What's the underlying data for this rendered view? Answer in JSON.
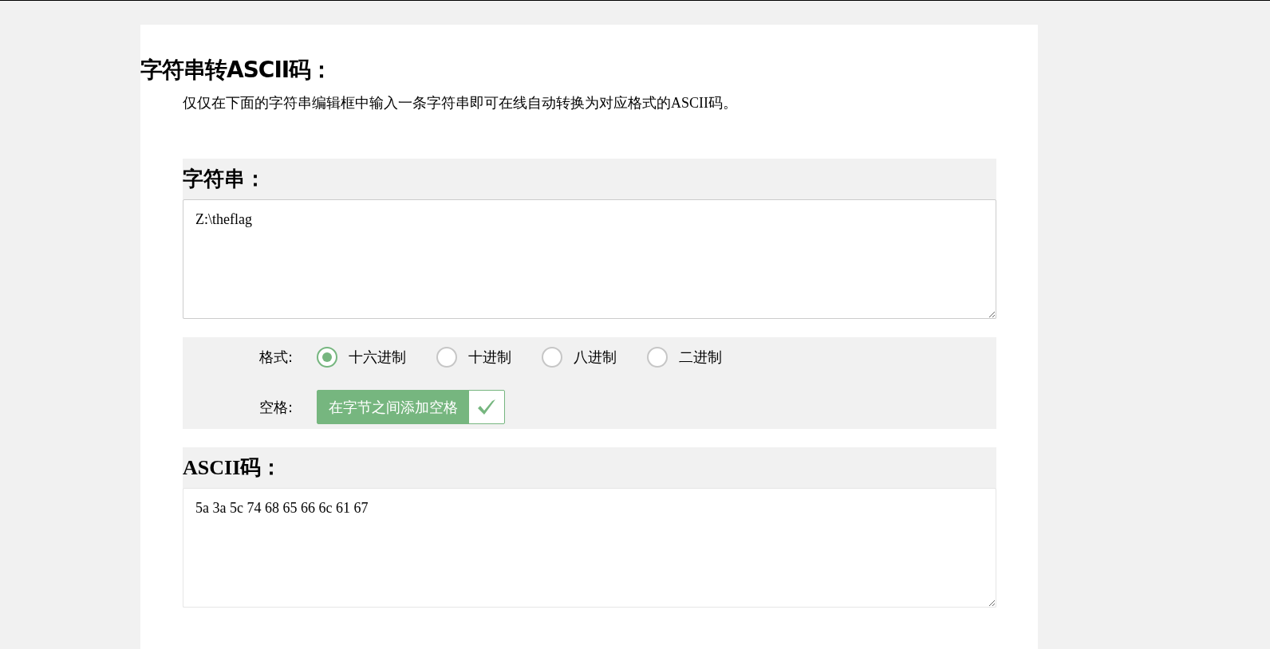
{
  "title": "字符串转ASCII码：",
  "intro": "仅仅在下面的字符串编辑框中输入一条字符串即可在线自动转换为对应格式的ASCII码。",
  "input_section": {
    "heading": "字符串：",
    "value": "Z:\\theflag"
  },
  "format": {
    "label": "格式:",
    "options": [
      {
        "label": "十六进制",
        "selected": true
      },
      {
        "label": "十进制",
        "selected": false
      },
      {
        "label": "八进制",
        "selected": false
      },
      {
        "label": "二进制",
        "selected": false
      }
    ]
  },
  "space": {
    "label": "空格:",
    "toggle_label": "在字节之间添加空格",
    "checked": true
  },
  "output_section": {
    "heading": "ASCII码：",
    "value": "5a 3a 5c 74 68 65 66 6c 61 67"
  }
}
